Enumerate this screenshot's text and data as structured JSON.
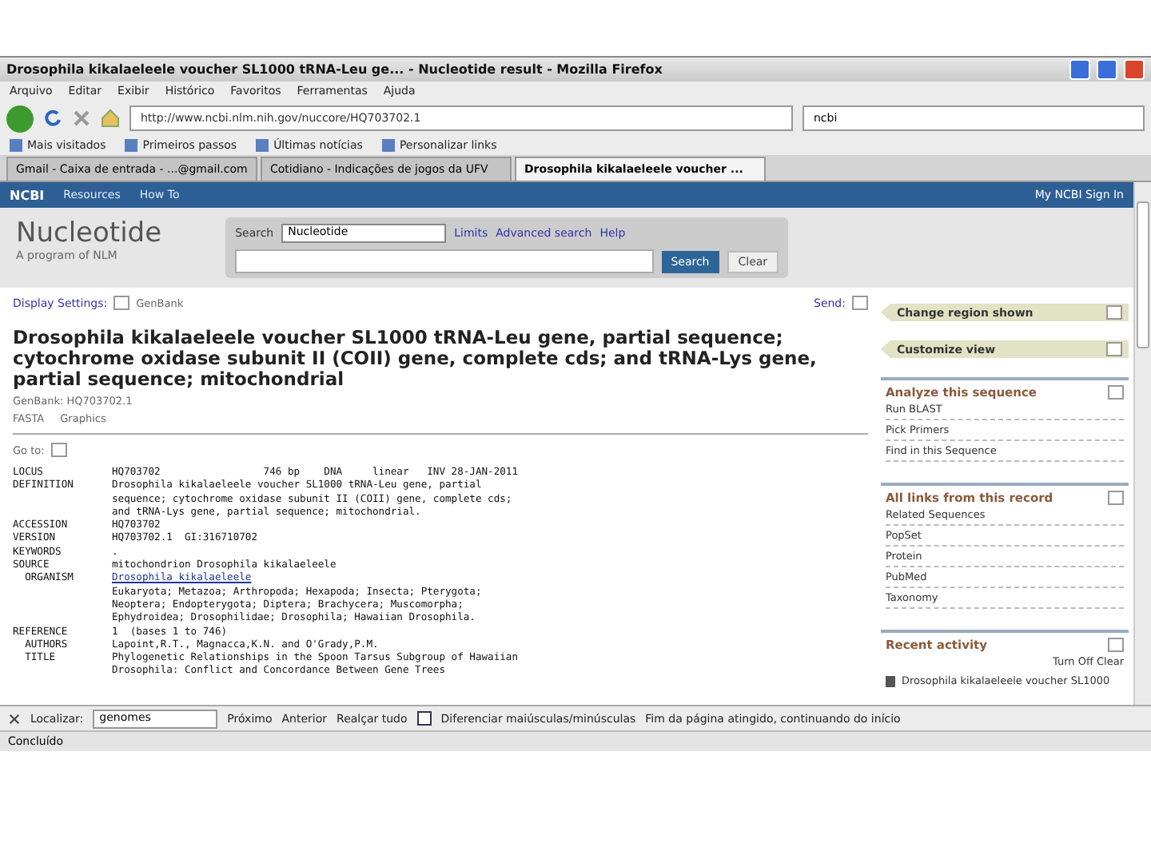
{
  "window": {
    "title": "Drosophila kikalaeleele voucher SL1000 tRNA-Leu ge... - Nucleotide result - Mozilla Firefox"
  },
  "menu": [
    "Arquivo",
    "Editar",
    "Exibir",
    "Histórico",
    "Favoritos",
    "Ferramentas",
    "Ajuda"
  ],
  "address": {
    "value": "http://www.ncbi.nlm.nih.gov/nuccore/HQ703702.1"
  },
  "web_search": {
    "value": "ncbi"
  },
  "bookmarks": [
    "Mais visitados",
    "Primeiros passos",
    "Últimas notícias",
    "Personalizar links"
  ],
  "tabs": [
    {
      "label": "Gmail - Caixa de entrada - ...@gmail.com",
      "selected": false
    },
    {
      "label": "Cotidiano - Indicações de jogos da UFV",
      "selected": false
    },
    {
      "label": "Drosophila kikalaeleele voucher ...",
      "selected": true
    }
  ],
  "ncbi_bar": {
    "logo": "NCBI",
    "links": [
      "Resources",
      "How To"
    ],
    "account": "My NCBI  Sign In"
  },
  "search_area": {
    "database_title": "Nucleotide",
    "tagline": "A program of NLM",
    "search_label": "Search",
    "database": "Nucleotide",
    "links": [
      "Limits",
      "Advanced search",
      "Help"
    ],
    "search_button": "Search",
    "clear_button": "Clear"
  },
  "display": {
    "settings": "Display Settings:",
    "format": "GenBank",
    "send": "Send:"
  },
  "record": {
    "title": "Drosophila kikalaeleele voucher SL1000 tRNA-Leu gene, partial sequence; cytochrome oxidase subunit II (COII) gene, complete cds; and tRNA-Lys gene, partial sequence; mitochondrial",
    "accession_line": "GenBank: HQ703702.1",
    "views": [
      "FASTA",
      "Graphics"
    ],
    "goto": "Go to:"
  },
  "flatfile": [
    {
      "key": "LOCUS",
      "text": "HQ703702                 746 bp    DNA     linear   INV 28-JAN-2011"
    },
    {
      "key": "DEFINITION",
      "text": "Drosophila kikalaeleele voucher SL1000 tRNA-Leu gene, partial"
    },
    {
      "text": "sequence; cytochrome oxidase subunit II (COII) gene, complete cds;"
    },
    {
      "text": "and tRNA-Lys gene, partial sequence; mitochondrial."
    },
    {
      "key": "ACCESSION",
      "text": "HQ703702"
    },
    {
      "key": "VERSION",
      "text": "HQ703702.1  GI:316710702"
    },
    {
      "key": "KEYWORDS",
      "text": "."
    },
    {
      "key": "SOURCE",
      "text": "mitochondrion Drosophila kikalaeleele"
    },
    {
      "key": "  ORGANISM",
      "text": "Drosophila kikalaeleele",
      "link": true
    },
    {
      "text": "Eukaryota; Metazoa; Arthropoda; Hexapoda; Insecta; Pterygota;"
    },
    {
      "text": "Neoptera; Endopterygota; Diptera; Brachycera; Muscomorpha;"
    },
    {
      "text": "Ephydroidea; Drosophilidae; Drosophila; Hawaiian Drosophila."
    },
    {
      "key": "REFERENCE",
      "text": "1  (bases 1 to 746)"
    },
    {
      "key": "  AUTHORS",
      "text": "Lapoint,R.T., Magnacca,K.N. and O'Grady,P.M."
    },
    {
      "key": "  TITLE",
      "text": "Phylogenetic Relationships in the Spoon Tarsus Subgroup of Hawaiian"
    },
    {
      "text": "Drosophila: Conflict and Concordance Between Gene Trees"
    }
  ],
  "sidebar": {
    "tabs": [
      "Change region shown",
      "Customize view"
    ],
    "sections": [
      {
        "title": "Analyze this sequence",
        "items": [
          "Run BLAST",
          "Pick Primers",
          "Find in this Sequence"
        ]
      },
      {
        "title": "All links from this record",
        "items": [
          "Related Sequences",
          "PopSet",
          "Protein",
          "PubMed",
          "Taxonomy"
        ]
      }
    ],
    "recent": {
      "title": "Recent activity",
      "controls": "Turn Off  Clear",
      "item": "Drosophila kikalaeleele voucher SL1000"
    }
  },
  "find_bar": {
    "label": "Localizar:",
    "value": "genomes",
    "next": "Próximo",
    "previous": "Anterior",
    "highlight": "Realçar tudo",
    "match_case": {
      "label": "Diferenciar maiúsculas/minúsculas",
      "checked": false
    },
    "message": "Fim da página atingido, continuando do início"
  },
  "status_bar": "Concluído"
}
